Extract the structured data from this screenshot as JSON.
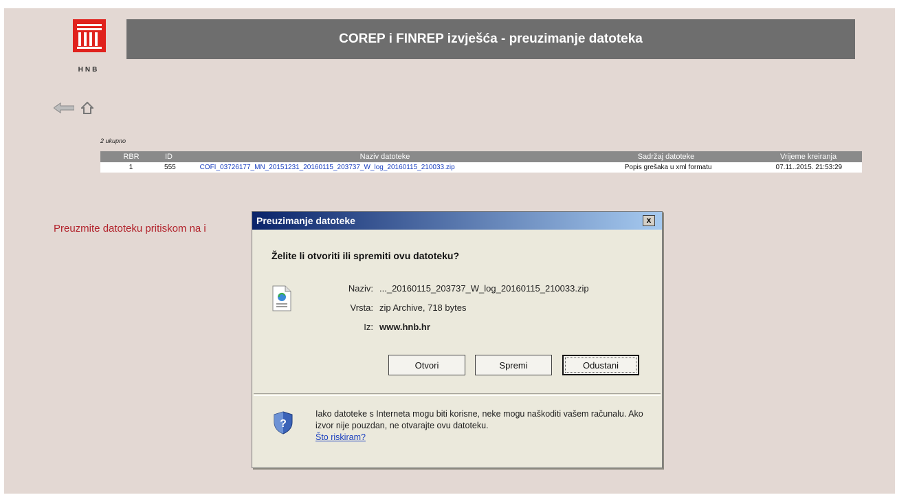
{
  "brand": {
    "logo_text": "HNB",
    "color": "#e0221d"
  },
  "header": {
    "title": "COREP i FINREP izvješća - preuzimanje datoteka"
  },
  "nav": {
    "back_icon": "back-arrow-icon",
    "home_icon": "home-icon"
  },
  "table": {
    "count_label": "2 ukupno",
    "headers": [
      "RBR",
      "ID",
      "Naziv datoteke",
      "Sadržaj datoteke",
      "Vrijeme kreiranja"
    ],
    "rows": [
      {
        "rbr": "1",
        "id": "555",
        "name": "COFI_03726177_MN_20151231_20160115_203737_W_log_20160115_210033.zip",
        "content": "Popis grešaka u xml formatu",
        "created": "07.11..2015. 21:53:29"
      }
    ]
  },
  "instruction": "Preuzmite datoteku pritiskom na i",
  "dialog": {
    "title": "Preuzimanje datoteke",
    "close": "x",
    "question": "Želite li otvoriti ili spremiti ovu datoteku?",
    "name_label": "Naziv:",
    "name_value": "..._20160115_203737_W_log_20160115_210033.zip",
    "type_label": "Vrsta:",
    "type_value": "zip Archive, 718 bytes",
    "from_label": "Iz:",
    "from_value": "www.hnb.hr",
    "buttons": {
      "open": "Otvori",
      "save": "Spremi",
      "cancel": "Odustani"
    },
    "warning_text": "Iako datoteke s Interneta mogu biti korisne, neke mogu naškoditi vašem računalu. Ako izvor nije pouzdan, ne otvarajte ovu datoteku.",
    "warning_link": "Što riskiram?"
  }
}
